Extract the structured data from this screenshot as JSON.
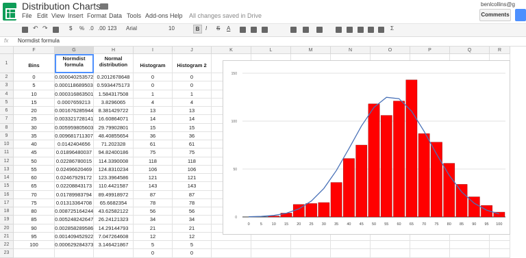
{
  "app": {
    "title": "Distribution Charts",
    "menu": [
      "File",
      "Edit",
      "View",
      "Insert",
      "Format",
      "Data",
      "Tools",
      "Add-ons",
      "Help"
    ],
    "saved_status": "All changes saved in Drive",
    "user": "benlcollins@g",
    "comments_label": "Comments",
    "icon": "sheets-logo"
  },
  "toolbar": {
    "currency": "$",
    "percent": "%",
    "dec_less": ".0",
    "dec_more": ".00",
    "number_format": "123",
    "font": "Arial",
    "font_size": "10",
    "bold": "B",
    "italic": "I",
    "strike": "S",
    "text_color": "A",
    "sigma": "Σ"
  },
  "formula_bar": {
    "fx": "fx",
    "value": "Normdist formula"
  },
  "columns": [
    "F",
    "G",
    "H",
    "I",
    "J",
    "K",
    "L",
    "M",
    "N",
    "O",
    "P",
    "Q",
    "R"
  ],
  "rows": [
    "1",
    "2",
    "3",
    "4",
    "5",
    "6",
    "7",
    "8",
    "9",
    "10",
    "11",
    "12",
    "13",
    "14",
    "15",
    "16",
    "17",
    "18",
    "19",
    "20",
    "21",
    "22",
    "23"
  ],
  "headers": {
    "F": "Bins",
    "G": "Normdist formula",
    "H": "Normal distribution",
    "I": "Histogram",
    "J": "Histogram 2"
  },
  "table": [
    [
      "0",
      "0.0000402535725",
      "0.2012678648",
      "0",
      "0"
    ],
    [
      "5",
      "0.0001186895035",
      "0.5934475173",
      "0",
      "0"
    ],
    [
      "10",
      "0.0003168635015",
      "1.584317508",
      "1",
      "1"
    ],
    [
      "15",
      "0.0007659213",
      "3.8296065",
      "4",
      "4"
    ],
    [
      "20",
      "0.001676285944",
      "8.381429722",
      "13",
      "13"
    ],
    [
      "25",
      "0.003321728141",
      "16.60864071",
      "14",
      "14"
    ],
    [
      "30",
      "0.005959805603",
      "29.79902801",
      "15",
      "15"
    ],
    [
      "35",
      "0.009681711307",
      "48.40855654",
      "36",
      "36"
    ],
    [
      "40",
      "0.0142404656",
      "71.202328",
      "61",
      "61"
    ],
    [
      "45",
      "0.01896480037",
      "94.82400186",
      "75",
      "75"
    ],
    [
      "50",
      "0.02286780015",
      "114.3390008",
      "118",
      "118"
    ],
    [
      "55",
      "0.02496620469",
      "124.8310234",
      "106",
      "106"
    ],
    [
      "60",
      "0.02467929172",
      "123.3964586",
      "121",
      "121"
    ],
    [
      "65",
      "0.02208843173",
      "110.4421587",
      "143",
      "143"
    ],
    [
      "70",
      "0.01789983794",
      "89.49918972",
      "87",
      "87"
    ],
    [
      "75",
      "0.01313364708",
      "65.6682354",
      "78",
      "78"
    ],
    [
      "80",
      "0.008725164244",
      "43.62582122",
      "56",
      "56"
    ],
    [
      "85",
      "0.005248242647",
      "26.24121323",
      "34",
      "34"
    ],
    [
      "90",
      "0.002858289586",
      "14.29144793",
      "21",
      "21"
    ],
    [
      "95",
      "0.001409452922",
      "7.047264608",
      "12",
      "12"
    ],
    [
      "100",
      "0.0006292843731",
      "3.146421867",
      "5",
      "5"
    ],
    [
      "",
      "",
      "",
      "0",
      "0"
    ]
  ],
  "chart_data": {
    "type": "bar",
    "categories": [
      "0",
      "5",
      "10",
      "15",
      "20",
      "25",
      "30",
      "35",
      "40",
      "45",
      "50",
      "55",
      "60",
      "65",
      "70",
      "75",
      "80",
      "85",
      "90",
      "95",
      "100"
    ],
    "series": [
      {
        "values": [
          0,
          0,
          1,
          4,
          13,
          14,
          15,
          36,
          61,
          75,
          118,
          106,
          121,
          143,
          87,
          78,
          56,
          34,
          21,
          12,
          5
        ],
        "color": "#ff0000"
      },
      {
        "values": [
          0.2012678648,
          0.5934475173,
          1.584317508,
          3.8296065,
          8.381429722,
          16.60864071,
          29.79902801,
          48.40855654,
          71.202328,
          94.82400186,
          114.3390008,
          124.8310234,
          123.3964586,
          110.4421587,
          89.49918972,
          65.6682354,
          43.62582122,
          26.24121323,
          14.29144793,
          7.047264608,
          3.146421867
        ],
        "color": "#4a72b8",
        "kind": "line"
      }
    ],
    "yticks": [
      "0",
      "50",
      "100",
      "150"
    ],
    "ylim": [
      0,
      150
    ],
    "grid": true
  }
}
